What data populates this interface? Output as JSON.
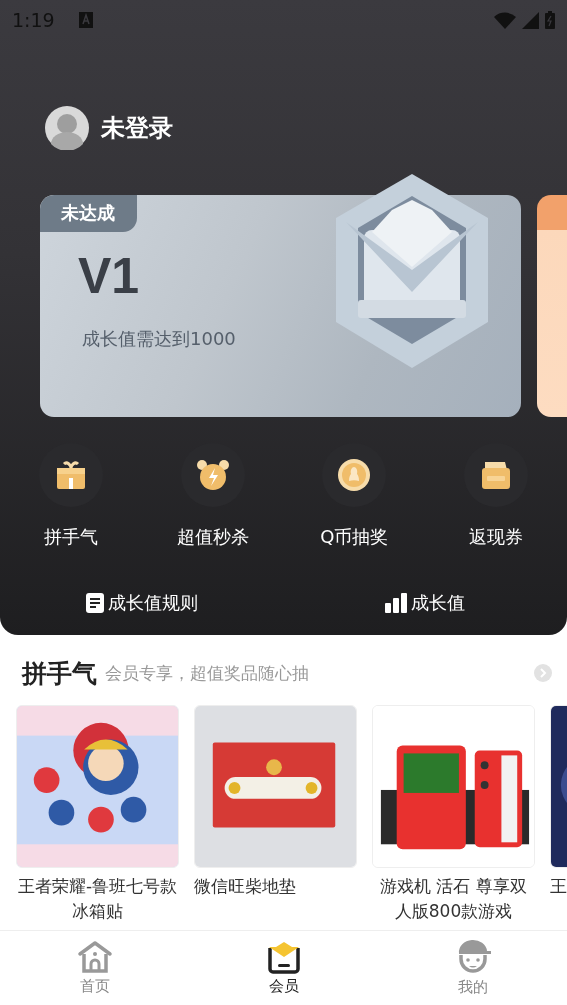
{
  "status_bar": {
    "time": "1:19"
  },
  "profile": {
    "name": "未登录"
  },
  "level_card": {
    "badge": "未达成",
    "level": "V1",
    "requirement": "成长值需达到1000"
  },
  "benefits": [
    {
      "label": "拼手气",
      "kind": "gift"
    },
    {
      "label": "超值秒杀",
      "kind": "alarm"
    },
    {
      "label": "Q币抽奖",
      "kind": "coin"
    },
    {
      "label": "返现券",
      "kind": "coupon"
    }
  ],
  "links": [
    {
      "label": "成长值规则",
      "kind": "document"
    },
    {
      "label": "成长值",
      "kind": "bars"
    }
  ],
  "section": {
    "title": "拼手气",
    "subtitle": "会员专享，超值奖品随心抽"
  },
  "products": [
    {
      "title": "王者荣耀-鲁班七号款冰箱贴",
      "kind": "picture"
    },
    {
      "title": "微信旺柴地垫",
      "kind": "picture"
    },
    {
      "title": "游戏机 活石 尊享双人版800款游戏",
      "kind": "picture"
    },
    {
      "title": "王",
      "kind": "picture"
    }
  ],
  "tabs": [
    {
      "label": "首页",
      "kind": "home",
      "selected": false
    },
    {
      "label": "会员",
      "kind": "member",
      "selected": true
    },
    {
      "label": "我的",
      "kind": "me",
      "selected": false
    }
  ]
}
